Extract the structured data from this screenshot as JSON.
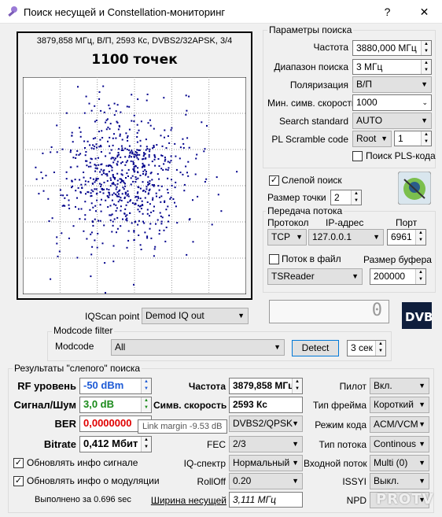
{
  "window": {
    "title": "Поиск несущей и Constellation-мониторинг",
    "help_label": "?",
    "close_label": "✕"
  },
  "constellation": {
    "header": "3879,858 МГц, В/П, 2593 Кс, DVBS2/32APSK, 3/4",
    "points_label": "1100 точек",
    "point_color": "#00008b"
  },
  "search_params": {
    "group_title": "Параметры поиска",
    "freq_label": "Частота",
    "freq_value": "3880,000 МГц",
    "range_label": "Диапазон поиска",
    "range_value": "3 МГц",
    "pol_label": "Поляризация",
    "pol_value": "В/П",
    "minsr_label": "Мин. симв. скорость",
    "minsr_value": "1000",
    "standard_label": "Search standard",
    "standard_value": "AUTO",
    "pls_label": "PL Scramble code",
    "pls_mode": "Root",
    "pls_value": "1",
    "pls_search_label": "Поиск PLS-кода"
  },
  "blind": {
    "label": "Слепой поиск",
    "point_size_label": "Размер точки",
    "point_size_value": "2"
  },
  "stream": {
    "group_title": "Передача потока",
    "proto_header": "Протокол",
    "ip_header": "IP-адрес",
    "port_header": "Порт",
    "proto_value": "TCP",
    "ip_value": "127.0.0.1",
    "port_value": "6961",
    "tofile_label": "Поток в файл",
    "bufsize_label": "Размер буфера",
    "reader_value": "TSReader",
    "bufsize_value": "200000"
  },
  "iq": {
    "label": "IQScan point",
    "value": "Demod IQ out",
    "counter": "0"
  },
  "modcode": {
    "group_title": "Modcode filter",
    "label": "Modcode",
    "value": "All",
    "detect_label": "Detect",
    "time_value": "3 сек"
  },
  "results": {
    "group_title": "Результаты \"слепого\" поиска",
    "rf_label": "RF уровень",
    "rf_value": "-50 dBm",
    "snr_label": "Сигнал/Шум",
    "snr_value": "3,0 dB",
    "ber_label": "BER",
    "ber_value": "0,0000000",
    "bitrate_label": "Bitrate",
    "bitrate_value": "0,412 Мбит",
    "freq_label": "Частота",
    "freq_value": "3879,858 МГц",
    "sr_label": "Симв. скорость",
    "sr_value": "2593 Кс",
    "std_value": "DVBS2/QPSK",
    "fec_label": "FEC",
    "fec_value": "2/3",
    "iqspec_label": "IQ-спектр",
    "iqspec_value": "Нормальный",
    "rolloff_label": "RollOff",
    "rolloff_value": "0.20",
    "bw_label": "Ширина несущей",
    "bw_value": "3,111 МГц",
    "pilot_label": "Пилот",
    "pilot_value": "Вкл.",
    "frame_label": "Тип фрейма",
    "frame_value": "Короткий",
    "mode_label": "Режим кода",
    "mode_value": "ACM/VCM",
    "stype_label": "Тип потока",
    "stype_value": "Continous",
    "input_label": "Входной поток",
    "input_value": "Multi (0)",
    "issyi_label": "ISSYI",
    "issyi_value": "Выкл.",
    "npd_label": "NPD",
    "upd_signal_label": "Обновлять инфо сигнале",
    "upd_mod_label": "Обновлять инфо о модуляции",
    "elapsed": "Выполнено за 0.696 sec"
  },
  "tooltip": "Link margin -9.53 dB",
  "watermark": "PROTV",
  "colors": {
    "rf": "#1e5bd6",
    "snr": "#1a8a1a",
    "ber": "#e00000"
  }
}
